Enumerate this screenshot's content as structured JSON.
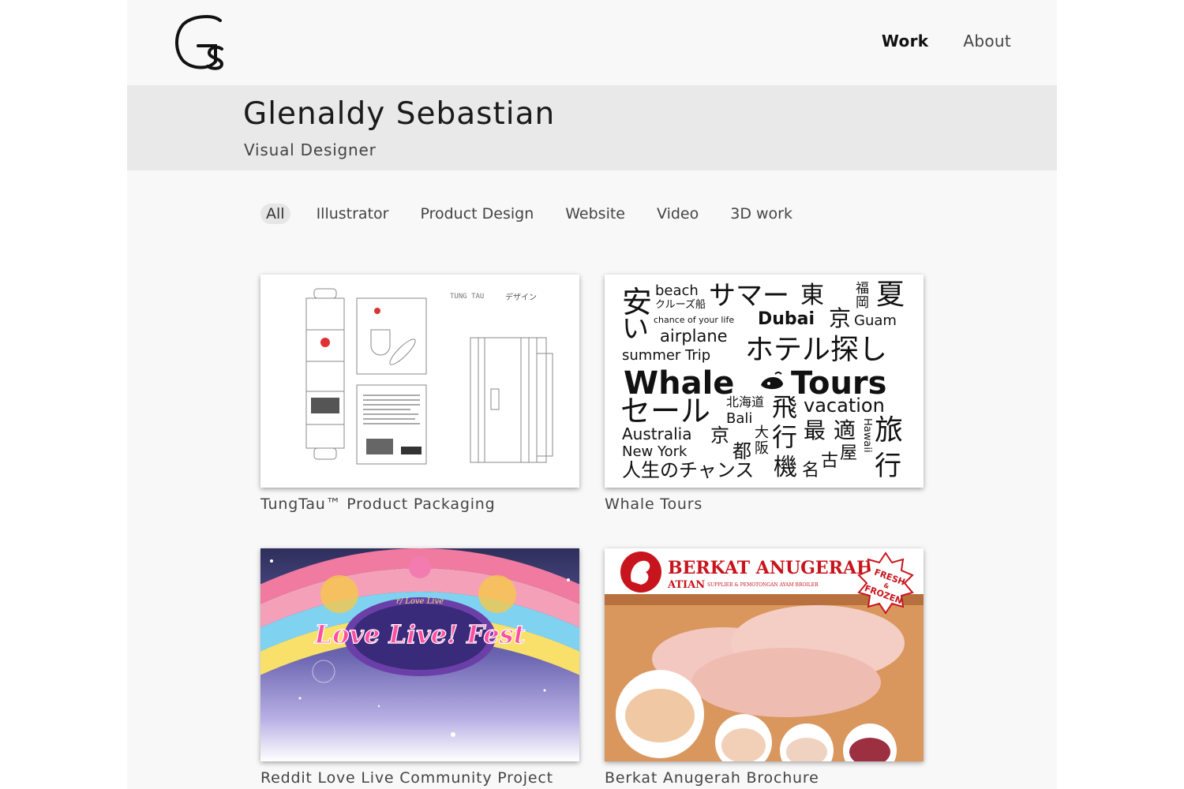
{
  "site": {
    "logo_text": "Gs",
    "nav": [
      {
        "label": "Work",
        "active": true
      },
      {
        "label": "About",
        "active": false
      }
    ]
  },
  "hero": {
    "name": "Glenaldy Sebastian",
    "title": "Visual Designer"
  },
  "filters": [
    {
      "label": "All",
      "active": true
    },
    {
      "label": "Illustrator",
      "active": false
    },
    {
      "label": "Product Design",
      "active": false
    },
    {
      "label": "Website",
      "active": false
    },
    {
      "label": "Video",
      "active": false
    },
    {
      "label": "3D work",
      "active": false
    }
  ],
  "projects": [
    {
      "caption": "TungTau™ Product Packaging",
      "thumb_text": [
        "TUNG TAU",
        "デザイン"
      ]
    },
    {
      "caption": "Whale Tours",
      "thumb_words": [
        "安",
        "beach",
        "クルーズ船",
        "サマー",
        "東",
        "福",
        "岡",
        "夏",
        "い",
        "chance of your life",
        "Dubai",
        "京",
        "Guam",
        "airplane",
        "summer Trip",
        "ホテル探し",
        "Whale",
        "Tours",
        "セール",
        "北海道",
        "Bali",
        "飛",
        "vacation",
        "Australia",
        "京",
        "大",
        "阪",
        "行",
        "最",
        "適",
        "Hawaii",
        "旅",
        "New York",
        "都",
        "屋",
        "人生のチャンス",
        "機",
        "名",
        "古",
        "行"
      ]
    },
    {
      "caption": "Reddit Love Live Community Project",
      "thumb_text": [
        "r/ Love Live",
        "Love Live! Fest"
      ]
    },
    {
      "caption": "Berkat Anugerah Brochure",
      "thumb_text": [
        "BERKAT ANUGERAH",
        "ATIAN",
        "SUPPLIER & PEMOTONGAN AYAM BROILER",
        "FRESH",
        "&",
        "FROZEN"
      ]
    }
  ],
  "colors": {
    "page_bg": "#f8f8f8",
    "hero_bg": "#e9e9e9",
    "filter_active_bg": "#e6e6e6",
    "brochure_red": "#c8141c"
  }
}
